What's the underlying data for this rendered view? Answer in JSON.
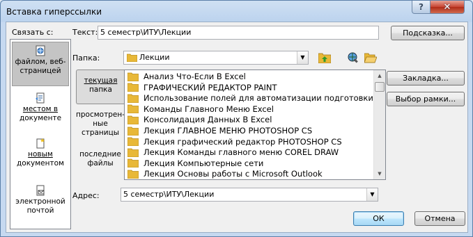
{
  "window": {
    "title": "Вставка гиперссылки",
    "help": "?",
    "close": "✕"
  },
  "link_to": {
    "heading": "Связать с:",
    "items": [
      {
        "line1": "файлом, веб-",
        "line2": "страницей"
      },
      {
        "line1": "местом в",
        "line2": "документе"
      },
      {
        "line1": "новым",
        "line2": "документом"
      },
      {
        "line1": "электронной",
        "line2": "почтой"
      }
    ]
  },
  "text_field": {
    "label": "Текст:",
    "value": "5 семестр\\ИТУ\\Лекции"
  },
  "screentip_button": "Подсказка...",
  "folder": {
    "label": "Папка:",
    "value": "Лекции"
  },
  "look_in": [
    {
      "line1": "текущая",
      "line2": "папка"
    },
    {
      "line1": "просмотрен-",
      "line2": "ные",
      "line3": "страницы"
    },
    {
      "line1": "последние",
      "line2": "файлы"
    }
  ],
  "files": [
    "Анализ Что-Если В Excel",
    "ГРАФИЧЕСКИЙ РЕДАКТОР PAINT",
    "Использование полей для автоматизации подготовки до",
    "Команды Главного Меню Excel",
    "Консолидация Данных В Excel",
    "Лекция ГЛАВНОЕ МЕНЮ PHOTOSHOP CS",
    "Лекция графический редактор PHOTOSHOP CS",
    "Лекция Команды главного меню COREL DRAW",
    "Лекция Компьютерные сети",
    "Лекция Основы работы с Microsoft Outlook"
  ],
  "bookmark_button": "Закладка...",
  "target_frame_button": "Выбор рамки...",
  "address": {
    "label": "Адрес:",
    "value": "5 семестр\\ИТУ\\Лекции"
  },
  "ok_button": "ОК",
  "cancel_button": "Отмена",
  "colors": {
    "folder": "#e8b838",
    "selection": "#c4c4c4",
    "client": "#f0f0f0"
  }
}
